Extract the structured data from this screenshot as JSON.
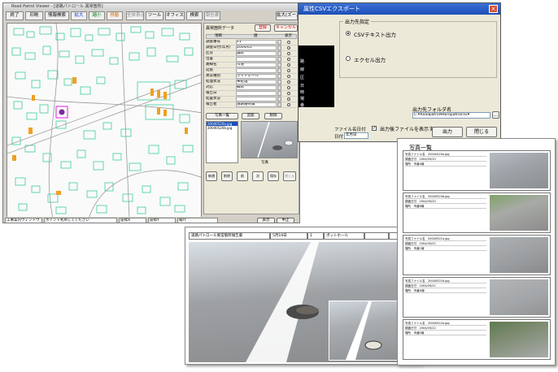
{
  "map_window": {
    "title": "Road Patrol Viewer - [道路パトロール 異常箇所]",
    "toolbar": [
      "終了",
      "印刷",
      "情報検索",
      "拡大",
      "縮小",
      "移動",
      "全体表示",
      "ツール",
      "オフィス",
      "検索",
      "報告書",
      "設定",
      "拡大(ズーム)"
    ],
    "status": [
      "工事案内ウィンドウ",
      "ポイント利用してください",
      "座標X",
      "座標Y",
      "縮尺",
      "表示",
      "中止"
    ],
    "panel": {
      "title": "異常箇所データ",
      "ok_label": "登録",
      "cancel_label": "キャンセル",
      "col_item": "項目",
      "col_value": "値",
      "col_flag": "表示",
      "fields": [
        {
          "name": "調査番号",
          "value": "21"
        },
        {
          "name": "調査日付(年月)",
          "value": "2004/05"
        },
        {
          "name": "区分",
          "value": "舗装"
        },
        {
          "name": "位置",
          "value": ""
        },
        {
          "name": "路線名",
          "value": "市道"
        },
        {
          "name": "延長",
          "value": ""
        },
        {
          "name": "異常種別",
          "value": "ポットホール"
        },
        {
          "name": "処理状況",
          "value": "未処理"
        },
        {
          "name": "対応",
          "value": "補修"
        },
        {
          "name": "報告日",
          "value": ""
        },
        {
          "name": "処置状況",
          "value": ""
        },
        {
          "name": "報告者",
          "value": "道路維持課"
        }
      ],
      "photo_section_label": "写真一覧",
      "photo_add_label": "追加",
      "photo_delete_label": "削除",
      "photo_files": [
        "20040520a.jpg",
        "20040520b.jpg"
      ],
      "photo_caption": "写真",
      "bottom_buttons": [
        "新規",
        "削除",
        "前",
        "次",
        "保存",
        "閉じる"
      ]
    }
  },
  "csv_dialog": {
    "title": "属性CSVエクスポート",
    "close_label": "×",
    "output_group_label": "出力先指定",
    "option_csv": "CSVテキスト出力",
    "option_excel": "エクセル出力",
    "folder_label": "出力先フォルダ名",
    "folder_value": "C:¥Roadpatrol¥doropatrolcsv¥",
    "browse_label": "…",
    "show_file_checkbox": "出力後ファイルを表示する",
    "filename_label": "ファイル名日付",
    "filename_option": "日付",
    "filename_select": "年月日",
    "output_button": "出力",
    "close_button": "閉じる",
    "left_list": [
      "路",
      "線",
      "区",
      "日",
      "時",
      "場",
      "番"
    ]
  },
  "photo_page": {
    "title": "写真一覧",
    "entries": [
      {
        "l1": "写真ファイル名　20040520a.jpg",
        "l2": "調査日付　2004/05/20",
        "l3": "場所　市道A線"
      },
      {
        "l1": "写真ファイル名　20040520b.jpg",
        "l2": "調査日付　2004/05/20",
        "l3": "場所　市道B線"
      },
      {
        "l1": "写真ファイル名　20040521a.jpg",
        "l2": "調査日付　2004/05/21",
        "l3": "場所　市道C線"
      },
      {
        "l1": "写真ファイル名　20040521b.jpg",
        "l2": "調査日付　2004/05/21",
        "l3": "場所　市道D線"
      },
      {
        "l1": "写真ファイル名　20040522a.jpg",
        "l2": "調査日付　2004/05/22",
        "l3": "場所　市道E線"
      }
    ]
  },
  "report_page": {
    "title": "道路パトロール異常箇所報告書",
    "cells": [
      "5月19日",
      "1",
      "ポットホール",
      "",
      ""
    ]
  }
}
